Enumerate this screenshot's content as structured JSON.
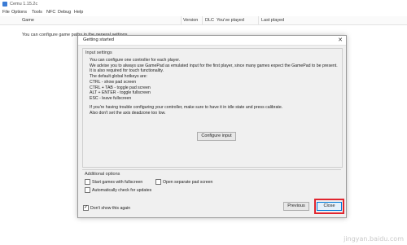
{
  "app": {
    "title": "Cemu 1.15.2c"
  },
  "menu": [
    "File",
    "Options",
    "Tools",
    "NFC",
    "Debug",
    "Help"
  ],
  "gamelist": {
    "columns": [
      "Game",
      "Version",
      "DLC",
      "You've played",
      "Last played"
    ],
    "config_hint": "You can configure game paths in the general settings"
  },
  "dialog": {
    "title": "Getting started",
    "close_glyph": "✕",
    "input_settings": {
      "title": "Input settings",
      "lines": [
        "You can configure one controller for each player.",
        "We advise you to always use GamePad as emulated input for the first player, since many games expect the GamePad to be present.",
        "It is also required for touch functionality.",
        "The default global hotkeys are:",
        "CTRL - show pad screen",
        "CTRL + TAB - toggle pad screen",
        "ALT + ENTER - toggle fullscreen",
        "ESC - leave fullscreen"
      ],
      "note_lines": [
        "If you're having trouble configuring your controller, make sure to have it in idle state and press calibrate.",
        "Also don't set the axis deadzone too low."
      ],
      "configure_button": "Configure input"
    },
    "additional_options": {
      "title": "Additional options",
      "start_fullscreen": "Start games with fullscreen",
      "open_pad_screen": "Open separate pad screen",
      "auto_check_updates": "Automatically check for updates"
    },
    "dont_show_again": "Don't show this again",
    "previous_button": "Previous",
    "close_button": "Close"
  },
  "watermark": "jingyan.baidu.com",
  "colors": {
    "highlight": "#e0252f",
    "accent": "#0078d7"
  }
}
